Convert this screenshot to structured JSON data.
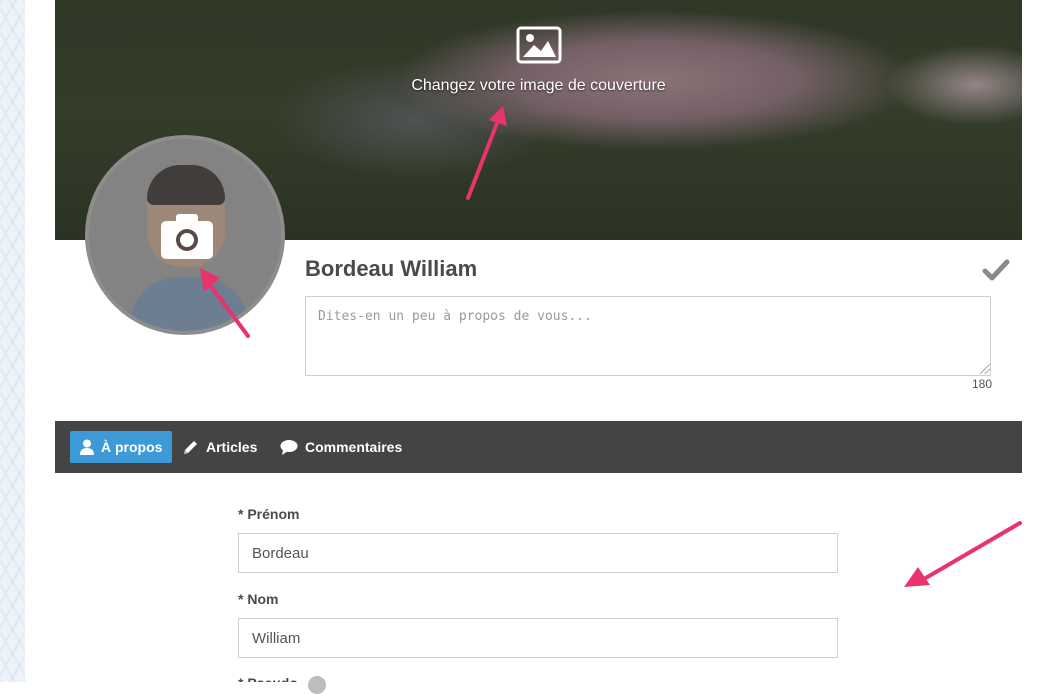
{
  "cover": {
    "change_label": "Changez votre image de couverture",
    "icon": "image-icon"
  },
  "avatar": {
    "icon": "camera-icon"
  },
  "profile": {
    "name": "Bordeau William",
    "save_icon": "check-icon",
    "bio_placeholder": "Dites-en un peu à propos de vous...",
    "bio_value": "",
    "char_count": "180"
  },
  "tabs": [
    {
      "label": "À propos",
      "icon": "user-icon",
      "active": true
    },
    {
      "label": "Articles",
      "icon": "pencil-icon",
      "active": false
    },
    {
      "label": "Commentaires",
      "icon": "comment-icon",
      "active": false
    }
  ],
  "form": {
    "prenom_label": "* Prénom",
    "prenom_value": "Bordeau",
    "nom_label": "* Nom",
    "nom_value": "William",
    "next_label": "* Pseudo"
  },
  "colors": {
    "accent": "#3d9ad6",
    "tabbar": "#444444",
    "annotation_arrow": "#e8336d"
  }
}
